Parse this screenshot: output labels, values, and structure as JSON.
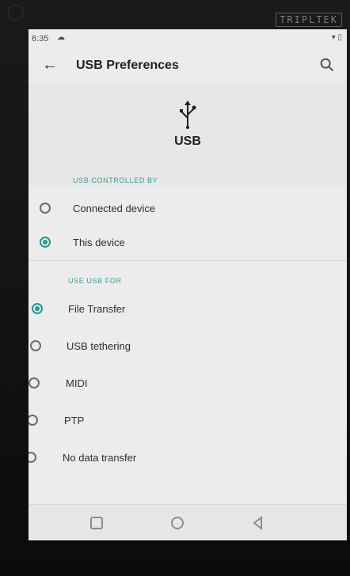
{
  "device": {
    "brand": "TRIPLTEK"
  },
  "status_bar": {
    "time": "6:35"
  },
  "app_bar": {
    "title": "USB Preferences"
  },
  "header": {
    "usb_label": "USB"
  },
  "sections": [
    {
      "title": "USB CONTROLLED BY",
      "options": [
        {
          "label": "Connected device",
          "selected": false
        },
        {
          "label": "This device",
          "selected": true
        }
      ]
    },
    {
      "title": "USE USB FOR",
      "options": [
        {
          "label": "File Transfer",
          "selected": true
        },
        {
          "label": "USB tethering",
          "selected": false
        },
        {
          "label": "MIDI",
          "selected": false
        },
        {
          "label": "PTP",
          "selected": false
        },
        {
          "label": "No data transfer",
          "selected": false
        }
      ]
    }
  ],
  "colors": {
    "accent": "#1f9b8f",
    "section_title": "#3a9d96",
    "screen_bg": "#ececec"
  },
  "icons": {
    "back": "arrow-left",
    "search": "magnifier",
    "usb": "usb-trident",
    "nav": [
      "square",
      "circle",
      "triangle-left"
    ]
  }
}
